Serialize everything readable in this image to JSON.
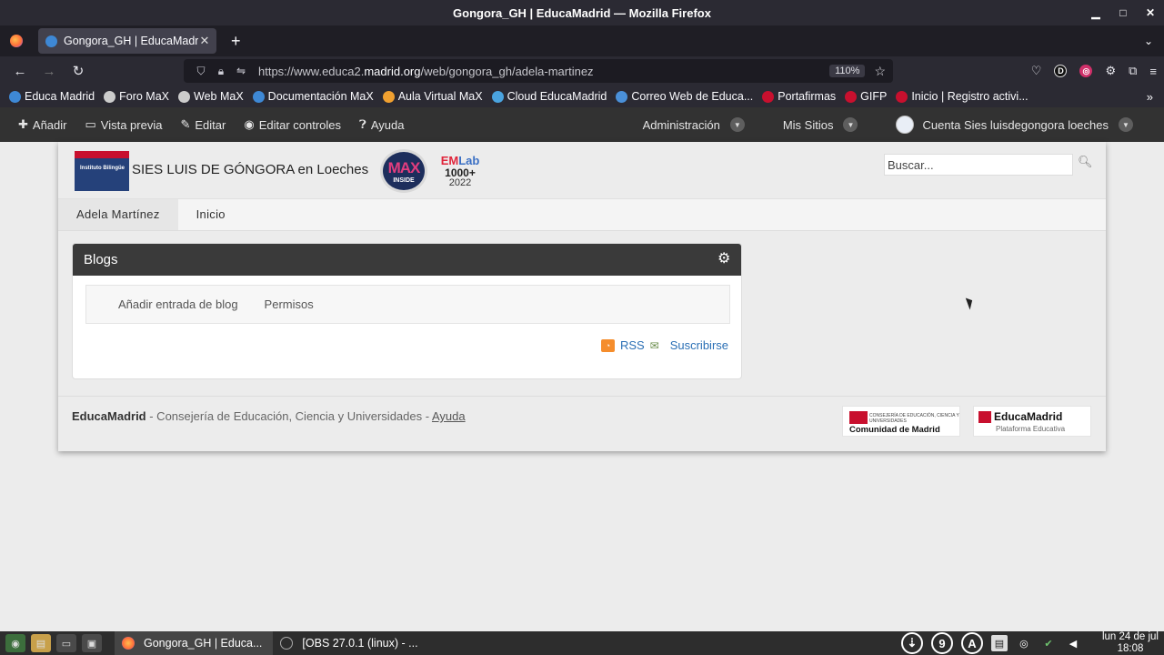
{
  "window": {
    "title": "Gongora_GH | EducaMadrid — Mozilla Firefox",
    "minimize": "▁",
    "maximize": "□",
    "close": "✕"
  },
  "tabs": [
    {
      "title": "Gongora_GH | EducaMadrid",
      "close": "✕"
    }
  ],
  "new_tab": "+",
  "tab_list": "⌄",
  "nav": {
    "back": "←",
    "forward": "→",
    "reload": "↻",
    "url_prefix": "https://www.educa2.",
    "url_domain": "madrid.org",
    "url_suffix": "/web/gongora_gh/adela-martinez",
    "zoom": "110%",
    "bookmark_star": "☆",
    "menu": "≡"
  },
  "bookmarks": [
    {
      "label": "Educa Madrid",
      "color": "#3e88d5"
    },
    {
      "label": "Foro MaX",
      "color": "#cccccc"
    },
    {
      "label": "Web MaX",
      "color": "#cccccc"
    },
    {
      "label": "Documentación MaX",
      "color": "#3e88d5"
    },
    {
      "label": "Aula Virtual MaX",
      "color": "#f0a030"
    },
    {
      "label": "Cloud EducaMadrid",
      "color": "#4aa3df"
    },
    {
      "label": "Correo Web de Educa...",
      "color": "#4a90d9"
    },
    {
      "label": "Portafirmas",
      "color": "#c8102e"
    },
    {
      "label": "GIFP",
      "color": "#c8102e"
    },
    {
      "label": "Inicio | Registro activi...",
      "color": "#c8102e"
    }
  ],
  "bookmarks_more": "»",
  "dockbar": {
    "add": "Añadir",
    "preview": "Vista previa",
    "edit": "Editar",
    "edit_controls": "Editar controles",
    "help": "Ayuda",
    "admin": "Administración",
    "my_sites": "Mis Sitios",
    "account": "Cuenta Sies luisdegongora loeches"
  },
  "site": {
    "logo_text": "Instituto Bilingüe",
    "name": "SIES LUIS DE GÓNGORA en Loeches",
    "max_big": "MAX",
    "max_small": "INSIDE",
    "emlab_em": "EM",
    "emlab_lab": "Lab",
    "emlab_count": "1000+",
    "emlab_year": "2022",
    "search_placeholder": "Buscar...",
    "nav": [
      "Adela Martínez",
      "Inicio"
    ]
  },
  "portlet": {
    "title": "Blogs",
    "add_entry": "Añadir entrada de blog",
    "permissions": "Permisos",
    "rss": "RSS",
    "subscribe": "Suscribirse"
  },
  "footer": {
    "brand": "EducaMadrid",
    "text": " - Consejería de Educación, Ciencia y Universidades - ",
    "help": "Ayuda",
    "badge1_small": "CONSEJERÍA DE EDUCACIÓN, CIENCIA Y UNIVERSIDADES",
    "badge1_big": "Comunidad de Madrid",
    "badge2_big": "EducaMadrid",
    "badge2_small": "Plataforma Educativa"
  },
  "taskbar": {
    "tasks": [
      "Gongora_GH | Educa...",
      "[OBS 27.0.1 (linux) - ..."
    ],
    "tray": [
      "9",
      "A"
    ],
    "date": "lun 24 de jul",
    "time": "18:08"
  }
}
